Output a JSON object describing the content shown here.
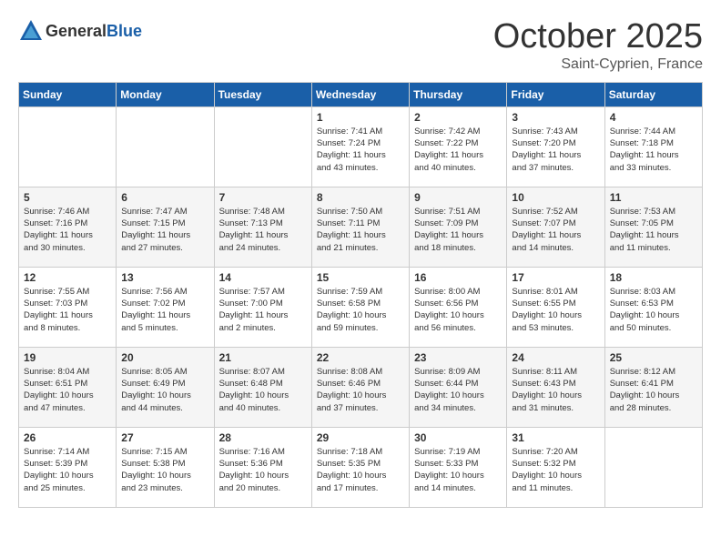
{
  "header": {
    "logo_general": "General",
    "logo_blue": "Blue",
    "month": "October 2025",
    "location": "Saint-Cyprien, France"
  },
  "weekdays": [
    "Sunday",
    "Monday",
    "Tuesday",
    "Wednesday",
    "Thursday",
    "Friday",
    "Saturday"
  ],
  "weeks": [
    [
      {
        "day": "",
        "info": ""
      },
      {
        "day": "",
        "info": ""
      },
      {
        "day": "",
        "info": ""
      },
      {
        "day": "1",
        "info": "Sunrise: 7:41 AM\nSunset: 7:24 PM\nDaylight: 11 hours\nand 43 minutes."
      },
      {
        "day": "2",
        "info": "Sunrise: 7:42 AM\nSunset: 7:22 PM\nDaylight: 11 hours\nand 40 minutes."
      },
      {
        "day": "3",
        "info": "Sunrise: 7:43 AM\nSunset: 7:20 PM\nDaylight: 11 hours\nand 37 minutes."
      },
      {
        "day": "4",
        "info": "Sunrise: 7:44 AM\nSunset: 7:18 PM\nDaylight: 11 hours\nand 33 minutes."
      }
    ],
    [
      {
        "day": "5",
        "info": "Sunrise: 7:46 AM\nSunset: 7:16 PM\nDaylight: 11 hours\nand 30 minutes."
      },
      {
        "day": "6",
        "info": "Sunrise: 7:47 AM\nSunset: 7:15 PM\nDaylight: 11 hours\nand 27 minutes."
      },
      {
        "day": "7",
        "info": "Sunrise: 7:48 AM\nSunset: 7:13 PM\nDaylight: 11 hours\nand 24 minutes."
      },
      {
        "day": "8",
        "info": "Sunrise: 7:50 AM\nSunset: 7:11 PM\nDaylight: 11 hours\nand 21 minutes."
      },
      {
        "day": "9",
        "info": "Sunrise: 7:51 AM\nSunset: 7:09 PM\nDaylight: 11 hours\nand 18 minutes."
      },
      {
        "day": "10",
        "info": "Sunrise: 7:52 AM\nSunset: 7:07 PM\nDaylight: 11 hours\nand 14 minutes."
      },
      {
        "day": "11",
        "info": "Sunrise: 7:53 AM\nSunset: 7:05 PM\nDaylight: 11 hours\nand 11 minutes."
      }
    ],
    [
      {
        "day": "12",
        "info": "Sunrise: 7:55 AM\nSunset: 7:03 PM\nDaylight: 11 hours\nand 8 minutes."
      },
      {
        "day": "13",
        "info": "Sunrise: 7:56 AM\nSunset: 7:02 PM\nDaylight: 11 hours\nand 5 minutes."
      },
      {
        "day": "14",
        "info": "Sunrise: 7:57 AM\nSunset: 7:00 PM\nDaylight: 11 hours\nand 2 minutes."
      },
      {
        "day": "15",
        "info": "Sunrise: 7:59 AM\nSunset: 6:58 PM\nDaylight: 10 hours\nand 59 minutes."
      },
      {
        "day": "16",
        "info": "Sunrise: 8:00 AM\nSunset: 6:56 PM\nDaylight: 10 hours\nand 56 minutes."
      },
      {
        "day": "17",
        "info": "Sunrise: 8:01 AM\nSunset: 6:55 PM\nDaylight: 10 hours\nand 53 minutes."
      },
      {
        "day": "18",
        "info": "Sunrise: 8:03 AM\nSunset: 6:53 PM\nDaylight: 10 hours\nand 50 minutes."
      }
    ],
    [
      {
        "day": "19",
        "info": "Sunrise: 8:04 AM\nSunset: 6:51 PM\nDaylight: 10 hours\nand 47 minutes."
      },
      {
        "day": "20",
        "info": "Sunrise: 8:05 AM\nSunset: 6:49 PM\nDaylight: 10 hours\nand 44 minutes."
      },
      {
        "day": "21",
        "info": "Sunrise: 8:07 AM\nSunset: 6:48 PM\nDaylight: 10 hours\nand 40 minutes."
      },
      {
        "day": "22",
        "info": "Sunrise: 8:08 AM\nSunset: 6:46 PM\nDaylight: 10 hours\nand 37 minutes."
      },
      {
        "day": "23",
        "info": "Sunrise: 8:09 AM\nSunset: 6:44 PM\nDaylight: 10 hours\nand 34 minutes."
      },
      {
        "day": "24",
        "info": "Sunrise: 8:11 AM\nSunset: 6:43 PM\nDaylight: 10 hours\nand 31 minutes."
      },
      {
        "day": "25",
        "info": "Sunrise: 8:12 AM\nSunset: 6:41 PM\nDaylight: 10 hours\nand 28 minutes."
      }
    ],
    [
      {
        "day": "26",
        "info": "Sunrise: 7:14 AM\nSunset: 5:39 PM\nDaylight: 10 hours\nand 25 minutes."
      },
      {
        "day": "27",
        "info": "Sunrise: 7:15 AM\nSunset: 5:38 PM\nDaylight: 10 hours\nand 23 minutes."
      },
      {
        "day": "28",
        "info": "Sunrise: 7:16 AM\nSunset: 5:36 PM\nDaylight: 10 hours\nand 20 minutes."
      },
      {
        "day": "29",
        "info": "Sunrise: 7:18 AM\nSunset: 5:35 PM\nDaylight: 10 hours\nand 17 minutes."
      },
      {
        "day": "30",
        "info": "Sunrise: 7:19 AM\nSunset: 5:33 PM\nDaylight: 10 hours\nand 14 minutes."
      },
      {
        "day": "31",
        "info": "Sunrise: 7:20 AM\nSunset: 5:32 PM\nDaylight: 10 hours\nand 11 minutes."
      },
      {
        "day": "",
        "info": ""
      }
    ]
  ]
}
